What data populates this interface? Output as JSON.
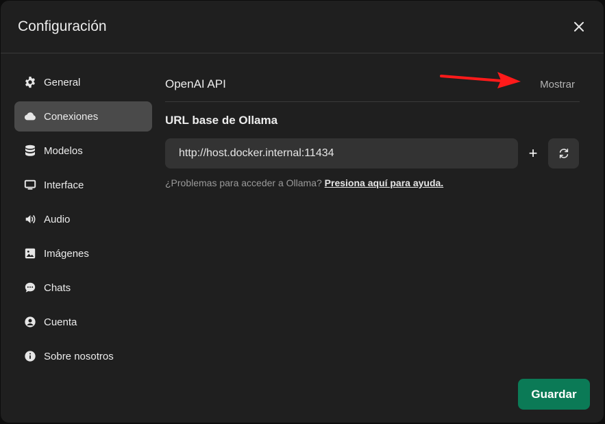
{
  "modal": {
    "title": "Configuración"
  },
  "sidebar": {
    "items": [
      {
        "label": "General",
        "icon": "gear-icon"
      },
      {
        "label": "Conexiones",
        "icon": "cloud-icon"
      },
      {
        "label": "Modelos",
        "icon": "database-icon"
      },
      {
        "label": "Interface",
        "icon": "monitor-icon"
      },
      {
        "label": "Audio",
        "icon": "speaker-icon"
      },
      {
        "label": "Imágenes",
        "icon": "image-icon"
      },
      {
        "label": "Chats",
        "icon": "chat-bubble-icon"
      },
      {
        "label": "Cuenta",
        "icon": "user-circle-icon"
      },
      {
        "label": "Sobre nosotros",
        "icon": "info-icon"
      }
    ],
    "active": "Conexiones"
  },
  "connections": {
    "openai_title": "OpenAI API",
    "show_label": "Mostrar",
    "ollama_title": "URL base de Ollama",
    "ollama_url": "http://host.docker.internal:11434",
    "add_label": "+",
    "help_prefix": "¿Problemas para acceder a Ollama? ",
    "help_link": "Presiona aquí para ayuda."
  },
  "footer": {
    "save_label": "Guardar"
  },
  "colors": {
    "accent": "#0b7a56",
    "annotation_arrow": "#ff1a1a"
  }
}
